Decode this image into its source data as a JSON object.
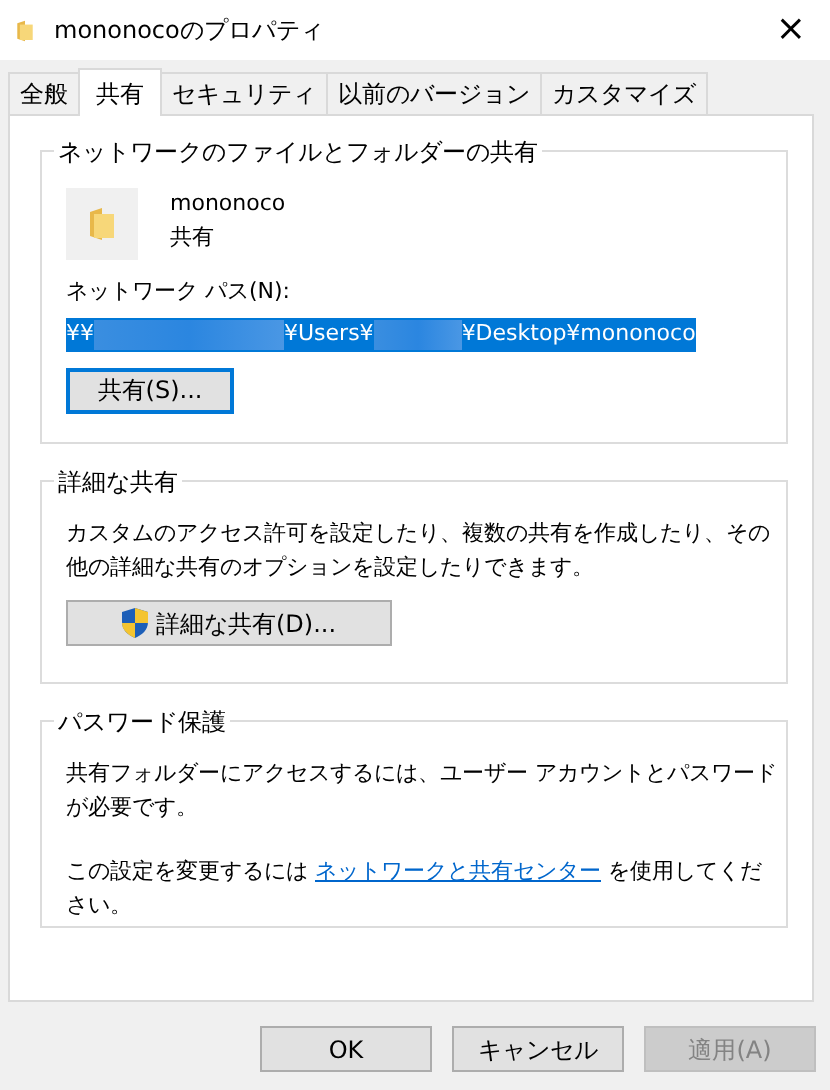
{
  "window": {
    "title": "mononocoのプロパティ",
    "close": "×"
  },
  "tabs": [
    {
      "label": "全般",
      "selected": false
    },
    {
      "label": "共有",
      "selected": true
    },
    {
      "label": "セキュリティ",
      "selected": false
    },
    {
      "label": "以前のバージョン",
      "selected": false
    },
    {
      "label": "カスタマイズ",
      "selected": false
    }
  ],
  "network_sharing": {
    "title": "ネットワークのファイルとフォルダーの共有",
    "folder_name": "mononoco",
    "share_status": "共有",
    "path_label": "ネットワーク パス(N):",
    "path_parts": [
      "¥¥",
      "¥Users¥",
      "¥Desktop¥mononoco"
    ],
    "share_button": "共有(S)..."
  },
  "advanced_sharing": {
    "title": "詳細な共有",
    "description": "カスタムのアクセス許可を設定したり、複数の共有を作成したり、その他の詳細な共有のオプションを設定したりできます。",
    "button": "詳細な共有(D)..."
  },
  "password_protection": {
    "title": "パスワード保護",
    "description": "共有フォルダーにアクセスするには、ユーザー アカウントとパスワードが必要です。",
    "change_prefix": "この設定を変更するには",
    "change_link": "ネットワークと共有センター",
    "change_suffix": "を使用してください。"
  },
  "buttons": [
    {
      "label": "OK",
      "disabled": false
    },
    {
      "label": "キャンセル",
      "disabled": false
    },
    {
      "label": "適用(A)",
      "disabled": true
    }
  ]
}
